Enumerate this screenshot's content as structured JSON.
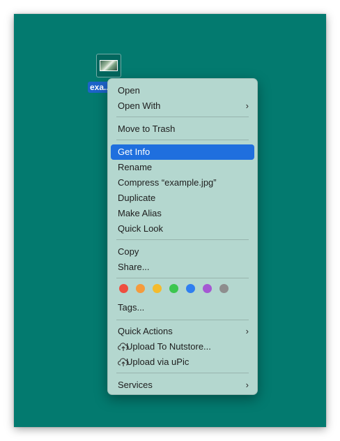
{
  "desktop": {
    "file_label": "exa...",
    "background": "#037a6f"
  },
  "menu": {
    "open": "Open",
    "open_with": "Open With",
    "move_to_trash": "Move to Trash",
    "get_info": "Get Info",
    "rename": "Rename",
    "compress": "Compress “example.jpg”",
    "duplicate": "Duplicate",
    "make_alias": "Make Alias",
    "quick_look": "Quick Look",
    "copy": "Copy",
    "share": "Share...",
    "tags": "Tags...",
    "quick_actions": "Quick Actions",
    "upload_nutstore": "Upload To Nutstore...",
    "upload_upic": "Upload via uPic",
    "services": "Services",
    "submenu_icon": "chevron-right-icon",
    "highlight_color": "#1f6fde"
  },
  "tag_colors": {
    "red": "#ee4f3f",
    "orange": "#f59b3c",
    "yellow": "#f4bb2c",
    "green": "#3cc64f",
    "blue": "#2f7ff0",
    "purple": "#a558d3",
    "gray": "#8e8e8e"
  }
}
